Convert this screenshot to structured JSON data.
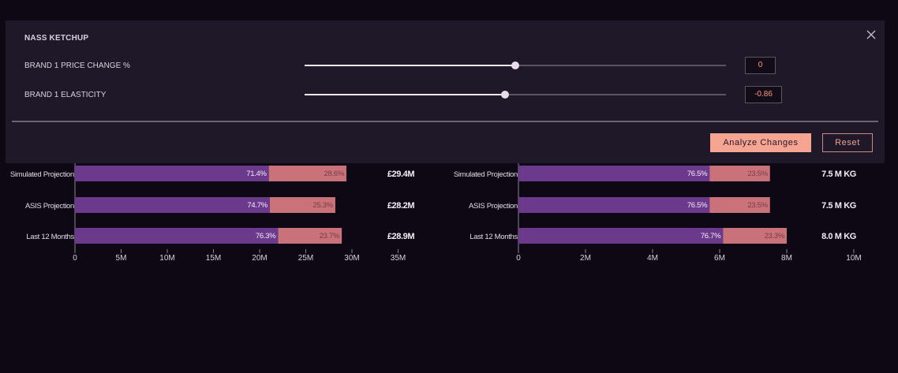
{
  "panel": {
    "title": "NASS KETCHUP",
    "close_icon": "close-icon",
    "sliders": [
      {
        "label": "BRAND 1 PRICE CHANGE %",
        "value_text": "0",
        "position": 0.5
      },
      {
        "label": "BRAND 1 ELASTICITY",
        "value_text": "-0.86",
        "position": 0.476
      }
    ],
    "analyze_label": "Analyze Changes",
    "reset_label": "Reset",
    "colors": {
      "accent": "#f5a592",
      "value_text": "#ff9a82"
    }
  },
  "chart_data": [
    {
      "type": "bar",
      "stacked": true,
      "orientation": "horizontal",
      "categories": [
        "Simulated Projection",
        "ASIS Projection",
        "Last 12 Months"
      ],
      "totals": [
        29.4,
        28.2,
        28.9
      ],
      "total_labels": [
        "£29.4M",
        "£28.2M",
        "£28.9M"
      ],
      "series": [
        {
          "values": [
            21.0,
            21.1,
            22.0
          ],
          "labels": [
            "71.4%",
            "74.7%",
            "76.3%"
          ],
          "color": "#6b3a8c"
        },
        {
          "values": [
            8.4,
            7.1,
            6.9
          ],
          "labels": [
            "28.6%",
            "25.3%",
            "23.7%"
          ],
          "color": "#c9727a"
        }
      ],
      "xlim": [
        0,
        35
      ],
      "xticks": [
        "0",
        "5M",
        "10M",
        "15M",
        "20M",
        "25M",
        "30M",
        "35M"
      ]
    },
    {
      "type": "bar",
      "stacked": true,
      "orientation": "horizontal",
      "categories": [
        "Simulated Projection",
        "ASIS Projection",
        "Last 12 Months"
      ],
      "totals": [
        7.5,
        7.5,
        8.0
      ],
      "total_labels": [
        "7.5 M KG",
        "7.5 M KG",
        "8.0 M KG"
      ],
      "series": [
        {
          "values": [
            5.7,
            5.7,
            6.1
          ],
          "labels": [
            "76.5%",
            "76.5%",
            "76.7%"
          ],
          "color": "#6b3a8c"
        },
        {
          "values": [
            1.8,
            1.8,
            1.9
          ],
          "labels": [
            "23.5%",
            "23.5%",
            "23.3%"
          ],
          "color": "#c9727a"
        }
      ],
      "xlim": [
        0,
        10
      ],
      "xticks": [
        "0",
        "2M",
        "4M",
        "6M",
        "8M",
        "10M"
      ]
    }
  ]
}
